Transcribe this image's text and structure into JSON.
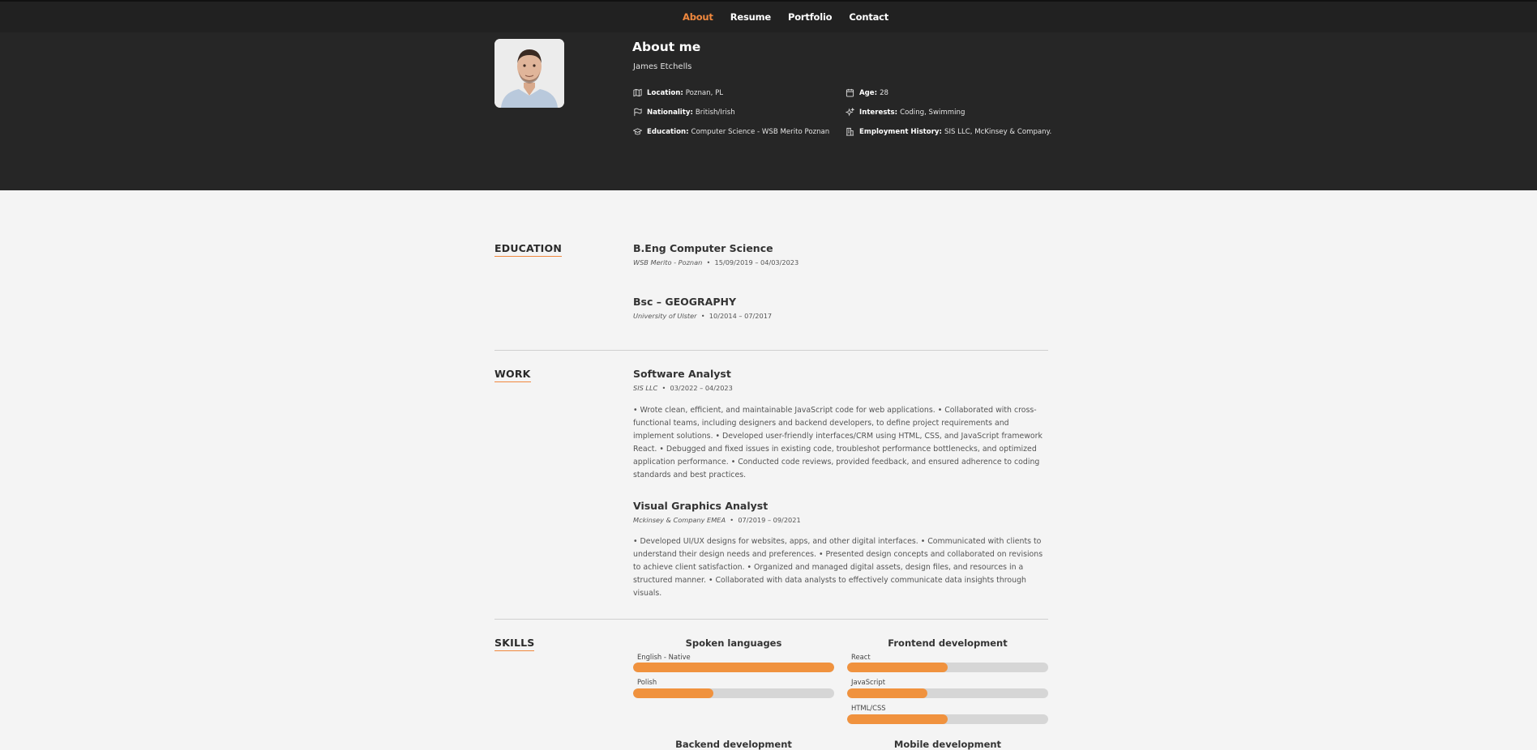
{
  "nav": {
    "items": [
      {
        "label": "About",
        "active": true
      },
      {
        "label": "Resume",
        "active": false
      },
      {
        "label": "Portfolio",
        "active": false
      },
      {
        "label": "Contact",
        "active": false
      }
    ]
  },
  "about": {
    "title": "About me",
    "name": "James Etchells",
    "location_label": "Location:",
    "location_value": "Poznan, PL",
    "nationality_label": "Nationality:",
    "nationality_value": "British/Irish",
    "education_label": "Education:",
    "education_value": "Computer Science - WSB Merito Poznan",
    "age_label": "Age:",
    "age_value": "28",
    "interests_label": "Interests:",
    "interests_value": "Coding, Swimming",
    "employment_label": "Employment History:",
    "employment_value": "SIS LLC, McKinsey & Company."
  },
  "education": {
    "label": "EDUCATION",
    "entries": [
      {
        "title": "B.Eng Computer Science",
        "school": "WSB Merito - Poznan",
        "dates": "15/09/2019 – 04/03/2023"
      },
      {
        "title": "Bsc – GEOGRAPHY",
        "school": "University of Ulster",
        "dates": "10/2014 – 07/2017"
      }
    ]
  },
  "work": {
    "label": "WORK",
    "entries": [
      {
        "title": "Software Analyst",
        "company": "SIS LLC",
        "dates": "03/2022 – 04/2023",
        "description": "• Wrote clean, efficient, and maintainable JavaScript code for web applications. • Collaborated with cross-functional teams, including designers and backend developers, to define project requirements and implement solutions. • Developed user-friendly interfaces/CRM using HTML, CSS, and JavaScript framework React. • Debugged and fixed issues in existing code, troubleshot performance bottlenecks, and optimized application performance. • Conducted code reviews, provided feedback, and ensured adherence to coding standards and best practices."
      },
      {
        "title": "Visual Graphics Analyst",
        "company": "Mckinsey & Company EMEA",
        "dates": "07/2019 – 09/2021",
        "description": "• Developed UI/UX designs for websites, apps, and other digital interfaces. • Communicated with clients to understand their design needs and preferences. • Presented design concepts and collaborated on revisions to achieve client satisfaction. • Organized and managed digital assets, design files, and resources in a structured manner. • Collaborated with data analysts to effectively communicate data insights through visuals."
      }
    ]
  },
  "skills": {
    "label": "SKILLS",
    "groups": [
      {
        "title": "Spoken languages",
        "items": [
          {
            "name": "English - Native",
            "level": 1.0
          },
          {
            "name": "Polish",
            "level": 0.4
          }
        ]
      },
      {
        "title": "Frontend development",
        "items": [
          {
            "name": "React",
            "level": 0.5
          },
          {
            "name": "JavaScript",
            "level": 0.4
          },
          {
            "name": "HTML/CSS",
            "level": 0.5
          }
        ]
      },
      {
        "title": "Backend development",
        "items": []
      },
      {
        "title": "Mobile development",
        "items": []
      }
    ]
  },
  "colors": {
    "accent": "#f0883e",
    "bar_fill": "#f0923e",
    "hero_bg": "#262626",
    "nav_bg": "#212121",
    "page_bg": "#f4f4f4"
  }
}
